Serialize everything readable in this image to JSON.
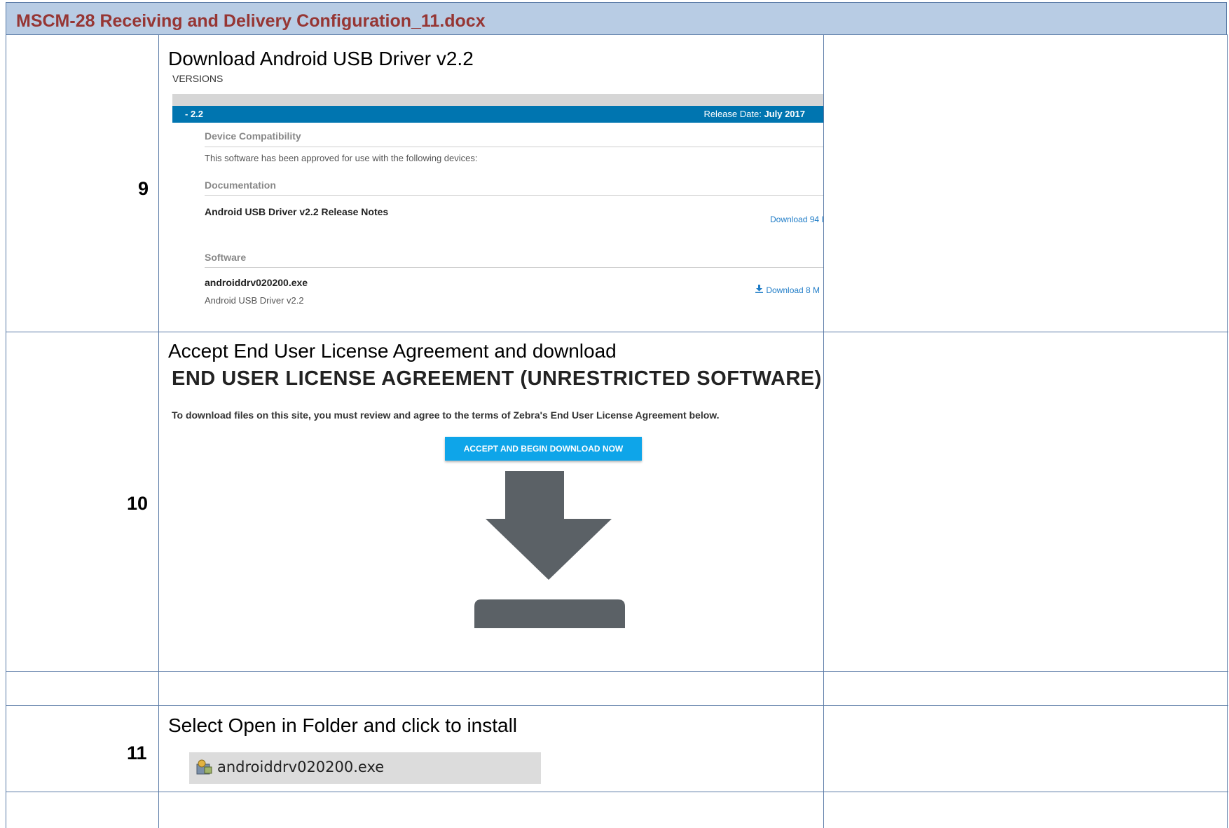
{
  "document": {
    "title": "MSCM-28 Receiving and Delivery Configuration_11.docx"
  },
  "steps": [
    {
      "number": "9",
      "heading": "Download Android USB Driver v2.2",
      "screenshot": {
        "versions_label": "VERSIONS",
        "version": "- 2.2",
        "release_label": "Release Date:",
        "release_date": "July 2017",
        "device_compat_title": "Device Compatibility",
        "device_compat_text": "This software has been approved for use with the following devices:",
        "documentation_title": "Documentation",
        "release_notes": "Android USB Driver v2.2 Release Notes",
        "release_notes_download": "Download 94 I",
        "software_title": "Software",
        "file_name": "androiddrv020200.exe",
        "file_desc": "Android USB Driver v2.2",
        "file_download": "Download 8 M"
      }
    },
    {
      "number": "10",
      "heading": "Accept End User License Agreement and download",
      "screenshot": {
        "eula_title": "END USER LICENSE AGREEMENT (UNRESTRICTED SOFTWARE)",
        "eula_sub": "To download files on this site, you must review and agree to the terms of Zebra's End User License Agreement below.",
        "accept_button": "ACCEPT AND BEGIN DOWNLOAD NOW",
        "icon": "download-arrow-icon"
      }
    },
    {
      "number": "11",
      "heading": "Select Open in Folder and click to install",
      "screenshot": {
        "file_name": "androiddrv020200.exe",
        "icon": "installer-icon"
      }
    }
  ],
  "colors": {
    "title_band": "#b8cce4",
    "title_text": "#963634",
    "grid_lines": "#5a7aa6",
    "blue_bar": "#0075b0",
    "accept_button": "#0ea5e9",
    "download_arrow": "#5b6166"
  }
}
